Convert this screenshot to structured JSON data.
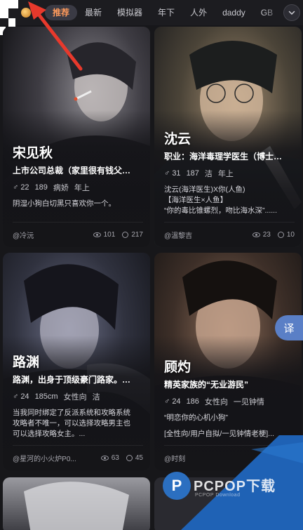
{
  "tabs": {
    "items": [
      "推荐",
      "最新",
      "模拟器",
      "年下",
      "人外",
      "daddy",
      "GB"
    ],
    "active_index": 0
  },
  "cards": [
    {
      "name": "宋见秋",
      "subtitle": "上市公司总裁（家里很有钱父…",
      "likes": "22",
      "tags": [
        "189",
        "病娇",
        "年上"
      ],
      "desc": [
        "阴湿小狗白切黑只喜欢你一个。"
      ],
      "author": "@冷沅",
      "views": "101",
      "comments": "217"
    },
    {
      "name": "沈云",
      "subtitle": "职业：海洋毒理学医生（博士…",
      "likes": "31",
      "tags": [
        "187",
        "洁",
        "年上"
      ],
      "desc": [
        "沈云(海洋医生)X你(人鱼)",
        "【海洋医生×人鱼】",
        "“你的毒比锥螺烈，吻比海水深”......"
      ],
      "author": "@溫黎吉",
      "views": "23",
      "comments": "10"
    },
    {
      "name": "路渊",
      "subtitle": "路渊，出身于顶级豪门路家。…",
      "likes": "24",
      "tags": [
        "185cm",
        "女性向",
        "洁"
      ],
      "desc": [
        "当我同时绑定了反派系统和攻略系统",
        "攻略者不唯一，可以选择攻略男主也",
        "可以选择攻略女主。..."
      ],
      "author": "@星河的小火炉P0...",
      "views": "63",
      "comments": "45"
    },
    {
      "name": "顾灼",
      "subtitle": "精英家族的“无业游民”",
      "likes": "24",
      "tags": [
        "186",
        "女性向",
        "一见钟情"
      ],
      "desc": [
        "“明恋你的心机小狗”",
        "",
        "[全性向/用户自拟/一见钟情老梗]..."
      ],
      "author": "@时刻",
      "views": "",
      "comments": ""
    }
  ],
  "translate_button": "译",
  "watermark": {
    "logo": "P",
    "text": "PCPOP下载",
    "sub": "PCPOP Download"
  },
  "colors": {
    "active_tab_text": "#ff9a5c",
    "background": "#17171a",
    "fab": "#5a7fc6",
    "watermark_blue": "#1f62b5"
  }
}
